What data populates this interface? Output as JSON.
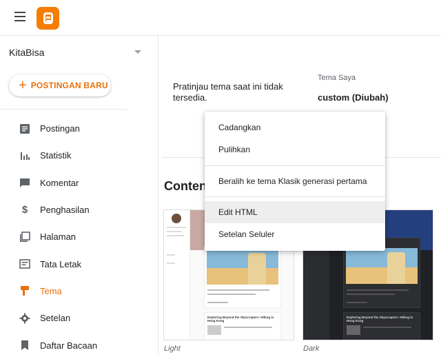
{
  "app": {
    "logo": "blogger-logo",
    "brand_color": "#f57d00"
  },
  "sidebar": {
    "blog_name": "KitaBisa",
    "new_post_label": "POSTINGAN BARU",
    "items": [
      {
        "label": "Postingan",
        "icon": "posts-icon"
      },
      {
        "label": "Statistik",
        "icon": "stats-icon"
      },
      {
        "label": "Komentar",
        "icon": "comment-icon"
      },
      {
        "label": "Penghasilan",
        "icon": "dollar-icon"
      },
      {
        "label": "Halaman",
        "icon": "pages-icon"
      },
      {
        "label": "Tata Letak",
        "icon": "layout-icon"
      },
      {
        "label": "Tema",
        "icon": "theme-icon",
        "active": true
      },
      {
        "label": "Setelan",
        "icon": "gear-icon"
      },
      {
        "label": "Daftar Bacaan",
        "icon": "bookmark-icon"
      }
    ],
    "active_color": "#e8710a"
  },
  "main": {
    "preview_unavailable": "Pratinjau tema saat ini tidak tersedia.",
    "my_theme_label": "Tema Saya",
    "my_theme_value": "custom (Diubah)",
    "section_heading": "Conten",
    "thumbnails": [
      {
        "caption": "Light"
      },
      {
        "caption": "Dark"
      }
    ],
    "mini_post_title": "Exploring Beyond the Skyscrapers: Hiking in Hong Kong"
  },
  "menu": {
    "items": [
      {
        "label": "Cadangkan"
      },
      {
        "label": "Pulihkan"
      },
      {
        "label": "Beralih ke tema Klasik generasi pertama"
      },
      {
        "label": "Edit HTML",
        "hovered": true
      },
      {
        "label": "Setelan Seluler"
      }
    ]
  }
}
